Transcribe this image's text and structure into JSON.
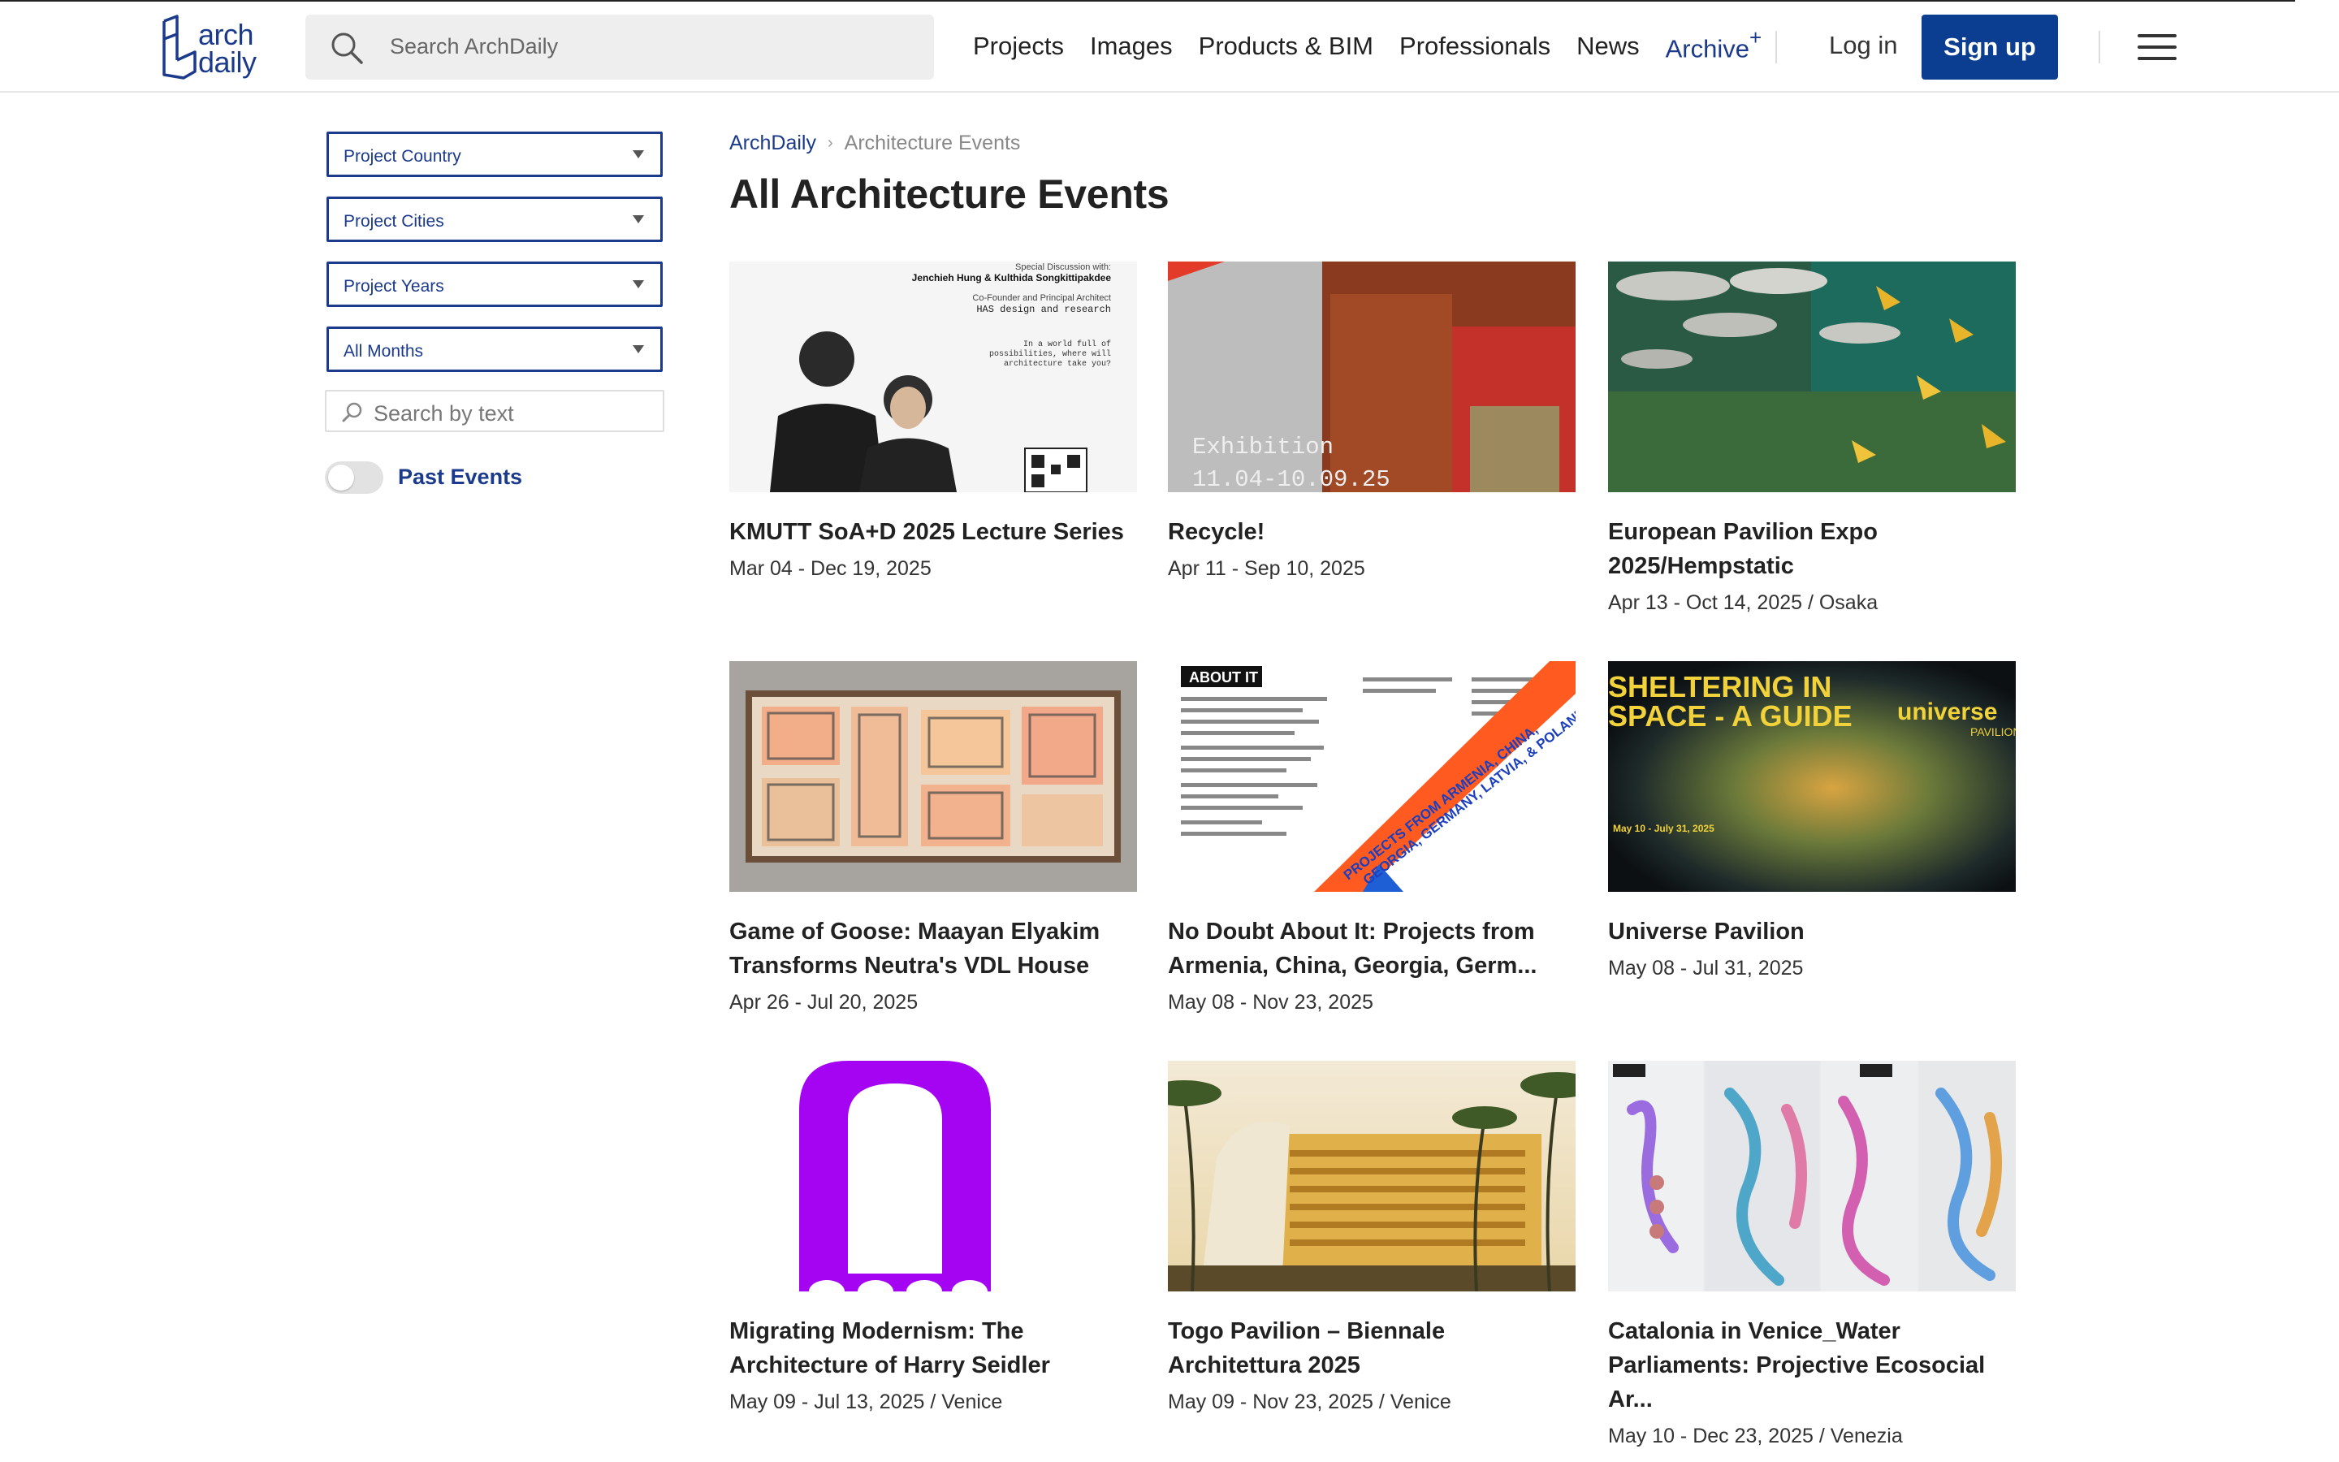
{
  "brand": {
    "logo_line1": "arch",
    "logo_line2": "daily",
    "accent": "#0b3d91",
    "link_color": "#1b3a8c"
  },
  "header": {
    "search_placeholder": "Search ArchDaily",
    "nav": [
      "Projects",
      "Images",
      "Products & BIM",
      "Professionals",
      "News"
    ],
    "archive_label": "Archive",
    "archive_plus": "+",
    "login_label": "Log in",
    "signup_label": "Sign up"
  },
  "filters": {
    "country": "Project Country",
    "cities": "Project Cities",
    "years": "Project Years",
    "months": "All Months",
    "text_search_placeholder": "Search by text",
    "past_events_label": "Past Events",
    "past_events_on": false
  },
  "breadcrumb": {
    "home": "ArchDaily",
    "separator": "›",
    "current": "Architecture Events"
  },
  "page_title": "All Architecture Events",
  "events": [
    {
      "title": "KMUTT SoA+D 2025 Lecture Series",
      "date": "Mar 04 - Dec 19, 2025",
      "poster_lines": [
        "Special Discussion with:",
        "Jenchieh Hung & Kulthida Songkittipakdee",
        "Co-Founder and Principal Architect",
        "HAS design and research",
        "In a world full of",
        "possibilities, where will",
        "architecture take you?"
      ]
    },
    {
      "title": "Recycle!",
      "date": "Apr 11 - Sep 10, 2025",
      "poster_lines": [
        "Exhibition",
        "11.04-10.09.25"
      ]
    },
    {
      "title": "European Pavilion Expo 2025/Hempstatic",
      "date": "Apr 13 - Oct 14, 2025 / Osaka"
    },
    {
      "title": "Game of Goose: Maayan Elyakim Transforms Neutra's VDL House",
      "date": "Apr 26 - Jul 20, 2025"
    },
    {
      "title": "No Doubt About It: Projects from Armenia, China, Georgia, Germ...",
      "date": "May 08 - Nov 23, 2025",
      "poster_lines": [
        "ABOUT IT",
        "PROJECTS FROM ARMENIA, CHINA,",
        "GEORGIA, GERMANY, LATVIA, & POLAND"
      ]
    },
    {
      "title": "Universe Pavilion",
      "date": "May 08 - Jul 31, 2025",
      "poster_lines": [
        "SHELTERING IN",
        "SPACE - A GUIDE",
        "universe",
        "PAVILION",
        "May 10 - July 31, 2025"
      ]
    },
    {
      "title": "Migrating Modernism: The Architecture of Harry Seidler",
      "date": "May 09 - Jul 13, 2025 / Venice"
    },
    {
      "title": "Togo Pavilion – Biennale Architettura 2025",
      "date": "May 09 - Nov 23, 2025 / Venice"
    },
    {
      "title": "Catalonia in Venice_Water Parliaments: Projective Ecosocial Ar...",
      "date": "May 10 - Dec 23, 2025 / Venezia"
    }
  ]
}
